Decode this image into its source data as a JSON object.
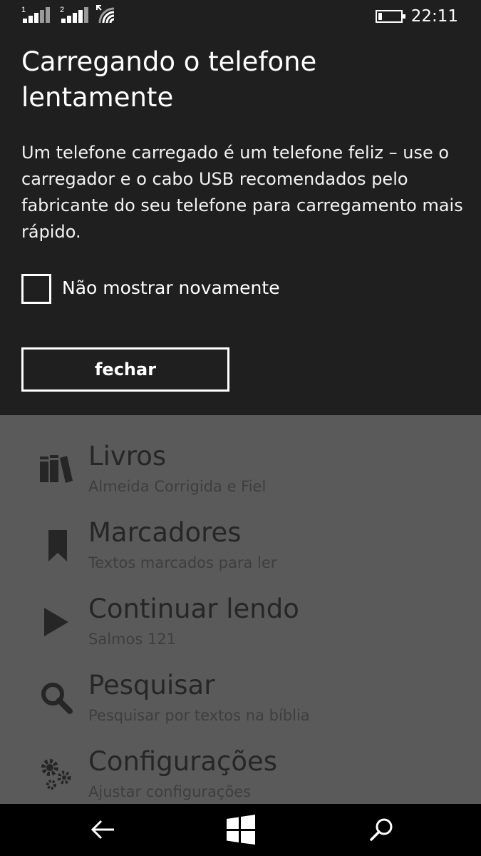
{
  "status_bar": {
    "sim1_label": "1",
    "sim2_label": "2",
    "time": "22:11"
  },
  "dialog": {
    "title": "Carregando o telefone lentamente",
    "message": "Um telefone carregado é um telefone feliz – use o carregador e o cabo USB recomendados pelo fabricante do seu telefone para carregamento mais rápido.",
    "checkbox_label": "Não mostrar novamente",
    "checkbox_checked": false,
    "close_label": "fechar"
  },
  "menu": {
    "items": [
      {
        "icon": "books-icon",
        "title": "Livros",
        "subtitle": "Almeida Corrigida e Fiel"
      },
      {
        "icon": "bookmark-icon",
        "title": "Marcadores",
        "subtitle": "Textos marcados para ler"
      },
      {
        "icon": "play-icon",
        "title": "Continuar lendo",
        "subtitle": "Salmos 121"
      },
      {
        "icon": "search-icon",
        "title": "Pesquisar",
        "subtitle": "Pesquisar por textos na bíblia"
      },
      {
        "icon": "gears-icon",
        "title": "Configurações",
        "subtitle": "Ajustar configurações"
      }
    ]
  },
  "nav_bar": {
    "icons": [
      "back-arrow-icon",
      "windows-logo-icon",
      "search-icon"
    ]
  },
  "colors": {
    "dialog_bg": "#1f1f1f",
    "overlay_bg": "#5a5a5a",
    "menu_text": "#262626",
    "nav_bg": "#000000"
  }
}
